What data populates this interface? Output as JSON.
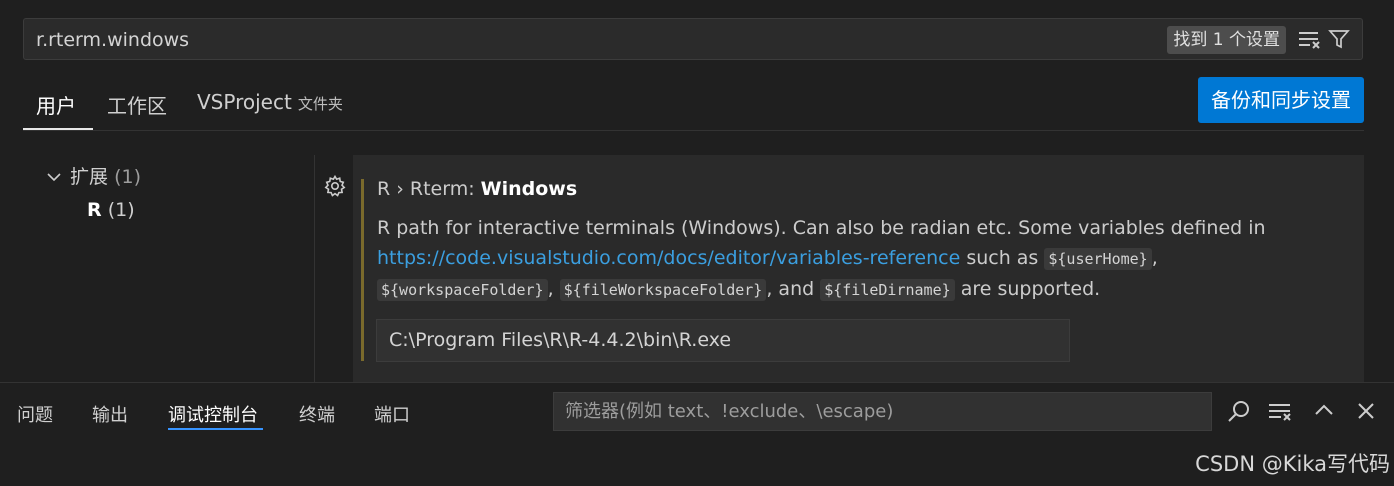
{
  "search": {
    "query": "r.rterm.windows",
    "found_badge": "找到 1 个设置"
  },
  "tabs": {
    "user": "用户",
    "workspace": "工作区",
    "folder": "VSProject",
    "folder_suffix": "文件夹"
  },
  "sync_button": "备份和同步设置",
  "toc": {
    "extensions_label": "扩展",
    "extensions_count": "(1)",
    "r_label": "R",
    "r_count": "(1)"
  },
  "setting": {
    "breadcrumb": "R › Rterm: ",
    "name": "Windows",
    "desc_1": "R path for interactive terminals (Windows). Can also be radian etc. Some variables defined in ",
    "link": "https://code.visualstudio.com/docs/editor/variables-reference",
    "desc_2": " such as ",
    "var_user_home": "${userHome}",
    "sep_comma": ",",
    "var_workspace": "${workspaceFolder}",
    "var_file_workspace": "${fileWorkspaceFolder}",
    "and": ", and ",
    "var_file_dirname": "${fileDirname}",
    "desc_3": " are supported.",
    "value": "C:\\Program Files\\R\\R-4.4.2\\bin\\R.exe"
  },
  "panel": {
    "tabs": [
      "问题",
      "输出",
      "调试控制台",
      "终端",
      "端口"
    ],
    "filter_placeholder": "筛选器(例如 text、!exclude、\\escape)"
  },
  "watermark": "CSDN @Kika写代码",
  "colors": {
    "accent": "#0078d4",
    "modified_bar": "#7a6a2c",
    "link": "#3b9fe0"
  }
}
